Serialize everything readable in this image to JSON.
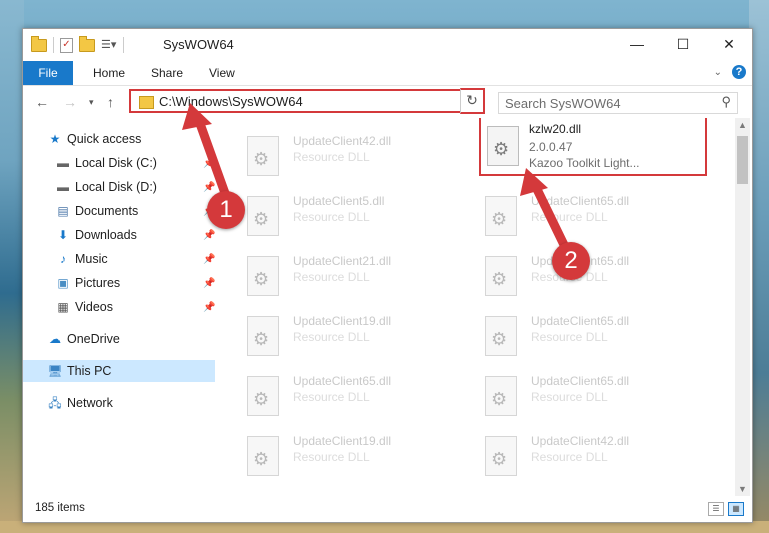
{
  "window": {
    "title": "SysWOW64"
  },
  "ribbon": {
    "tabs": [
      "File",
      "Home",
      "Share",
      "View"
    ]
  },
  "nav": {
    "address": "C:\\Windows\\SysWOW64",
    "search_placeholder": "Search SysWOW64"
  },
  "sidebar": {
    "items": [
      {
        "label": "Quick access",
        "icon": "star-icon",
        "pinned": false
      },
      {
        "label": "Local Disk (C:)",
        "icon": "drive-icon",
        "pinned": true
      },
      {
        "label": "Local Disk (D:)",
        "icon": "drive-icon",
        "pinned": true
      },
      {
        "label": "Documents",
        "icon": "documents-icon",
        "pinned": true
      },
      {
        "label": "Downloads",
        "icon": "download-icon",
        "pinned": true
      },
      {
        "label": "Music",
        "icon": "music-icon",
        "pinned": true
      },
      {
        "label": "Pictures",
        "icon": "pictures-icon",
        "pinned": true
      },
      {
        "label": "Videos",
        "icon": "videos-icon",
        "pinned": true
      },
      {
        "label": "OneDrive",
        "icon": "cloud-icon",
        "pinned": false
      },
      {
        "label": "This PC",
        "icon": "computer-icon",
        "pinned": false,
        "selected": true
      },
      {
        "label": "Network",
        "icon": "network-icon",
        "pinned": false
      }
    ]
  },
  "files": {
    "left": [
      {
        "name": "UpdateClient42.dll",
        "type": "Resource DLL"
      },
      {
        "name": "UpdateClient5.dll",
        "type": "Resource DLL"
      },
      {
        "name": "UpdateClient21.dll",
        "type": "Resource DLL"
      },
      {
        "name": "UpdateClient19.dll",
        "type": "Resource DLL"
      },
      {
        "name": "UpdateClient65.dll",
        "type": "Resource DLL"
      },
      {
        "name": "UpdateClient19.dll",
        "type": "Resource DLL"
      }
    ],
    "right": [
      {
        "name": "kzlw20.dll",
        "type": "2.0.0.47",
        "desc": "Kazoo Toolkit Light...",
        "selected": true
      },
      {
        "name": "UpdateClient65.dll",
        "type": "Resource DLL"
      },
      {
        "name": "UpdateClient65.dll",
        "type": "Resource DLL"
      },
      {
        "name": "UpdateClient65.dll",
        "type": "Resource DLL"
      },
      {
        "name": "UpdateClient65.dll",
        "type": "Resource DLL"
      },
      {
        "name": "UpdateClient42.dll",
        "type": "Resource DLL"
      }
    ]
  },
  "status": {
    "count": "185 items"
  },
  "callouts": [
    "1",
    "2"
  ],
  "colors": {
    "accent": "#1979ca",
    "highlight": "#d4393b",
    "selected_bg": "#cce8ff"
  }
}
